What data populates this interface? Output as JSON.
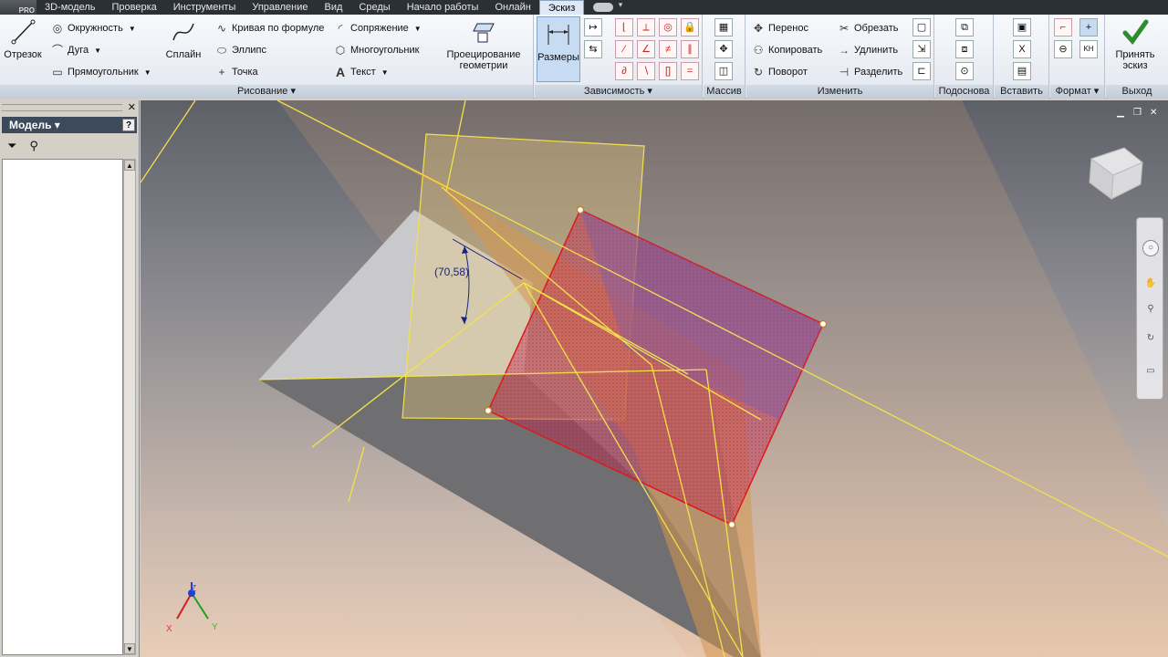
{
  "app": {
    "logo_text": "PRO"
  },
  "tabs": [
    {
      "label": "3D-модель"
    },
    {
      "label": "Проверка"
    },
    {
      "label": "Инструменты"
    },
    {
      "label": "Управление"
    },
    {
      "label": "Вид"
    },
    {
      "label": "Среды"
    },
    {
      "label": "Начало работы"
    },
    {
      "label": "Онлайн"
    },
    {
      "label": "Эскиз"
    }
  ],
  "ribbon": {
    "draw": {
      "title": "Рисование",
      "line": "Отрезок",
      "circle": "Окружность",
      "arc": "Дуга",
      "rectangle": "Прямоугольник",
      "spline": "Сплайн",
      "curve_formula": "Кривая по формуле",
      "ellipse": "Эллипс",
      "point": "Точка",
      "fillet": "Сопряжение",
      "polygon": "Многоугольник",
      "text": "Текст",
      "project_geometry_1": "Проецирование",
      "project_geometry_2": "геометрии"
    },
    "constrain": {
      "title": "Зависимость",
      "dimension": "Размеры"
    },
    "pattern": {
      "title": "Массив"
    },
    "modify": {
      "title": "Изменить",
      "move": "Перенос",
      "copy": "Копировать",
      "rotate": "Поворот",
      "trim": "Обрезать",
      "extend": "Удлинить",
      "split": "Разделить"
    },
    "layout": {
      "title": "Подоснова"
    },
    "insert": {
      "title": "Вставить"
    },
    "format": {
      "title": "Формат"
    },
    "exit": {
      "title": "Выход",
      "finish_1": "Принять",
      "finish_2": "эскиз"
    }
  },
  "browser": {
    "title": "Модель",
    "help": "?"
  },
  "viewport": {
    "dimension_label": "(70,58)",
    "axis_x": "X",
    "axis_y": "Y",
    "axis_z": "Z"
  }
}
